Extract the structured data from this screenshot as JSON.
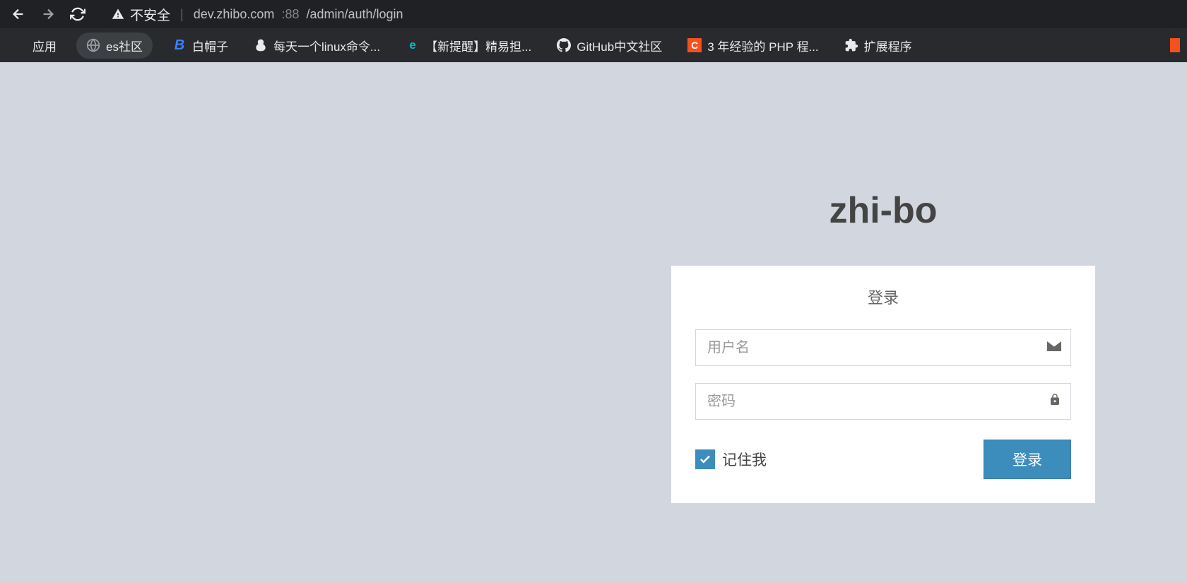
{
  "browser": {
    "security_label": "不安全",
    "url_host": "dev.zhibo.com",
    "url_port": ":88",
    "url_path": "/admin/auth/login"
  },
  "bookmarks": {
    "apps": "应用",
    "items": [
      {
        "label": "es社区"
      },
      {
        "label": "白帽子"
      },
      {
        "label": "每天一个linux命令..."
      },
      {
        "label": "【新提醒】精易担..."
      },
      {
        "label": "GitHub中文社区"
      },
      {
        "label": "3 年经验的 PHP 程..."
      },
      {
        "label": "扩展程序"
      }
    ]
  },
  "login": {
    "brand": "zhi-bo",
    "title": "登录",
    "username_placeholder": "用户名",
    "password_placeholder": "密码",
    "remember_label": "记住我",
    "submit_label": "登录"
  }
}
